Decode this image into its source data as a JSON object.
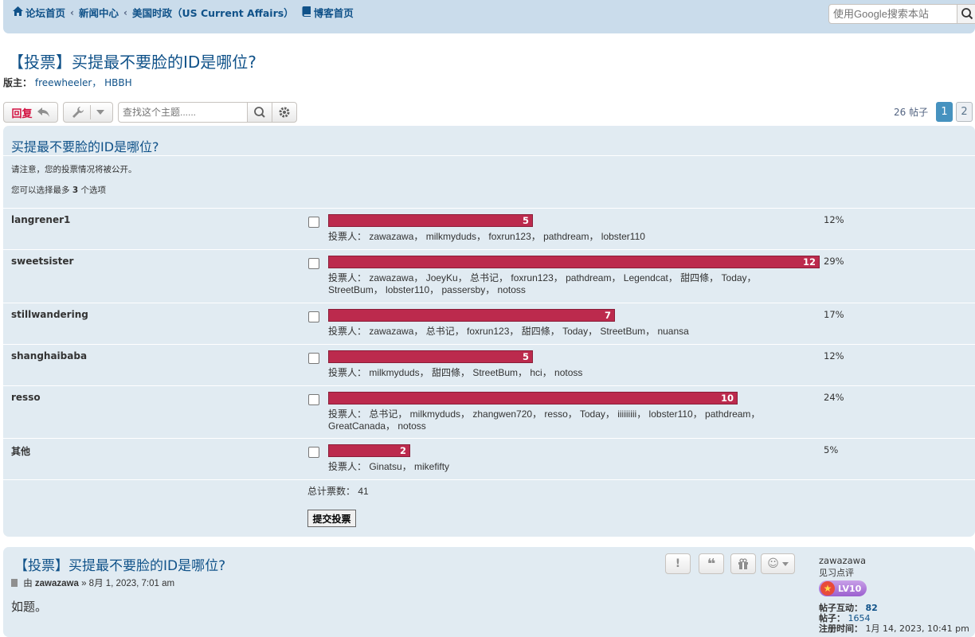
{
  "nav": {
    "home": "论坛首页",
    "news": "新闻中心",
    "forum": "美国时政（US Current Affairs）",
    "blog": "博客首页",
    "search_placeholder": "使用Google搜索本站"
  },
  "topic": {
    "title": "【投票】买提最不要脸的ID是哪位?",
    "mods_label": "版主：",
    "mods": "freewheeler， HBBH",
    "reply_label": "回复",
    "search_placeholder": "查找这个主题......",
    "post_count": "26 帖子",
    "pages": [
      "1",
      "2"
    ]
  },
  "poll": {
    "question": "买提最不要脸的ID是哪位?",
    "notice": "请注意，您的投票情况将被公开。",
    "max_prefix": "您可以选择最多",
    "max_value": "3",
    "max_suffix": "个选项",
    "options": [
      {
        "name": "langrener1",
        "votes": "5",
        "pct": "12%",
        "voters": "投票人： zawazawa， milkmyduds， foxrun123， pathdream， lobster110"
      },
      {
        "name": "sweetsister",
        "votes": "12",
        "pct": "29%",
        "voters": "投票人： zawazawa， JoeyKu， 总书记， foxrun123， pathdream， Legendcat， 甜四條， Today， StreetBum， lobster110， passersby， notoss"
      },
      {
        "name": "stillwandering",
        "votes": "7",
        "pct": "17%",
        "voters": "投票人： zawazawa， 总书记， foxrun123， 甜四條， Today， StreetBum， nuansa"
      },
      {
        "name": "shanghaibaba",
        "votes": "5",
        "pct": "12%",
        "voters": "投票人： milkmyduds， 甜四條， StreetBum， hci， notoss"
      },
      {
        "name": "resso",
        "votes": "10",
        "pct": "24%",
        "voters": "投票人： 总书记， milkmyduds， zhangwen720， resso， Today， iiiiiiiii， lobster110， pathdream， GreatCanada， notoss"
      },
      {
        "name": "其他",
        "votes": "2",
        "pct": "5%",
        "voters": "投票人： Ginatsu， mikefifty"
      }
    ],
    "total": "总计票数： 41",
    "submit": "提交投票"
  },
  "post": {
    "title": "【投票】买提最不要脸的ID是哪位?",
    "by": "由",
    "author": "zawazawa",
    "date": "» 8月 1, 2023, 7:01 am",
    "body": "如题。"
  },
  "profile": {
    "name": "zawazawa",
    "rank": "见习点评",
    "level": "LV10",
    "interactions_label": "帖子互动：",
    "interactions": "82",
    "posts_label": "帖子：",
    "posts": "1654",
    "joined_label": "注册时间：",
    "joined": "1月 14, 2023, 10:41 pm"
  }
}
